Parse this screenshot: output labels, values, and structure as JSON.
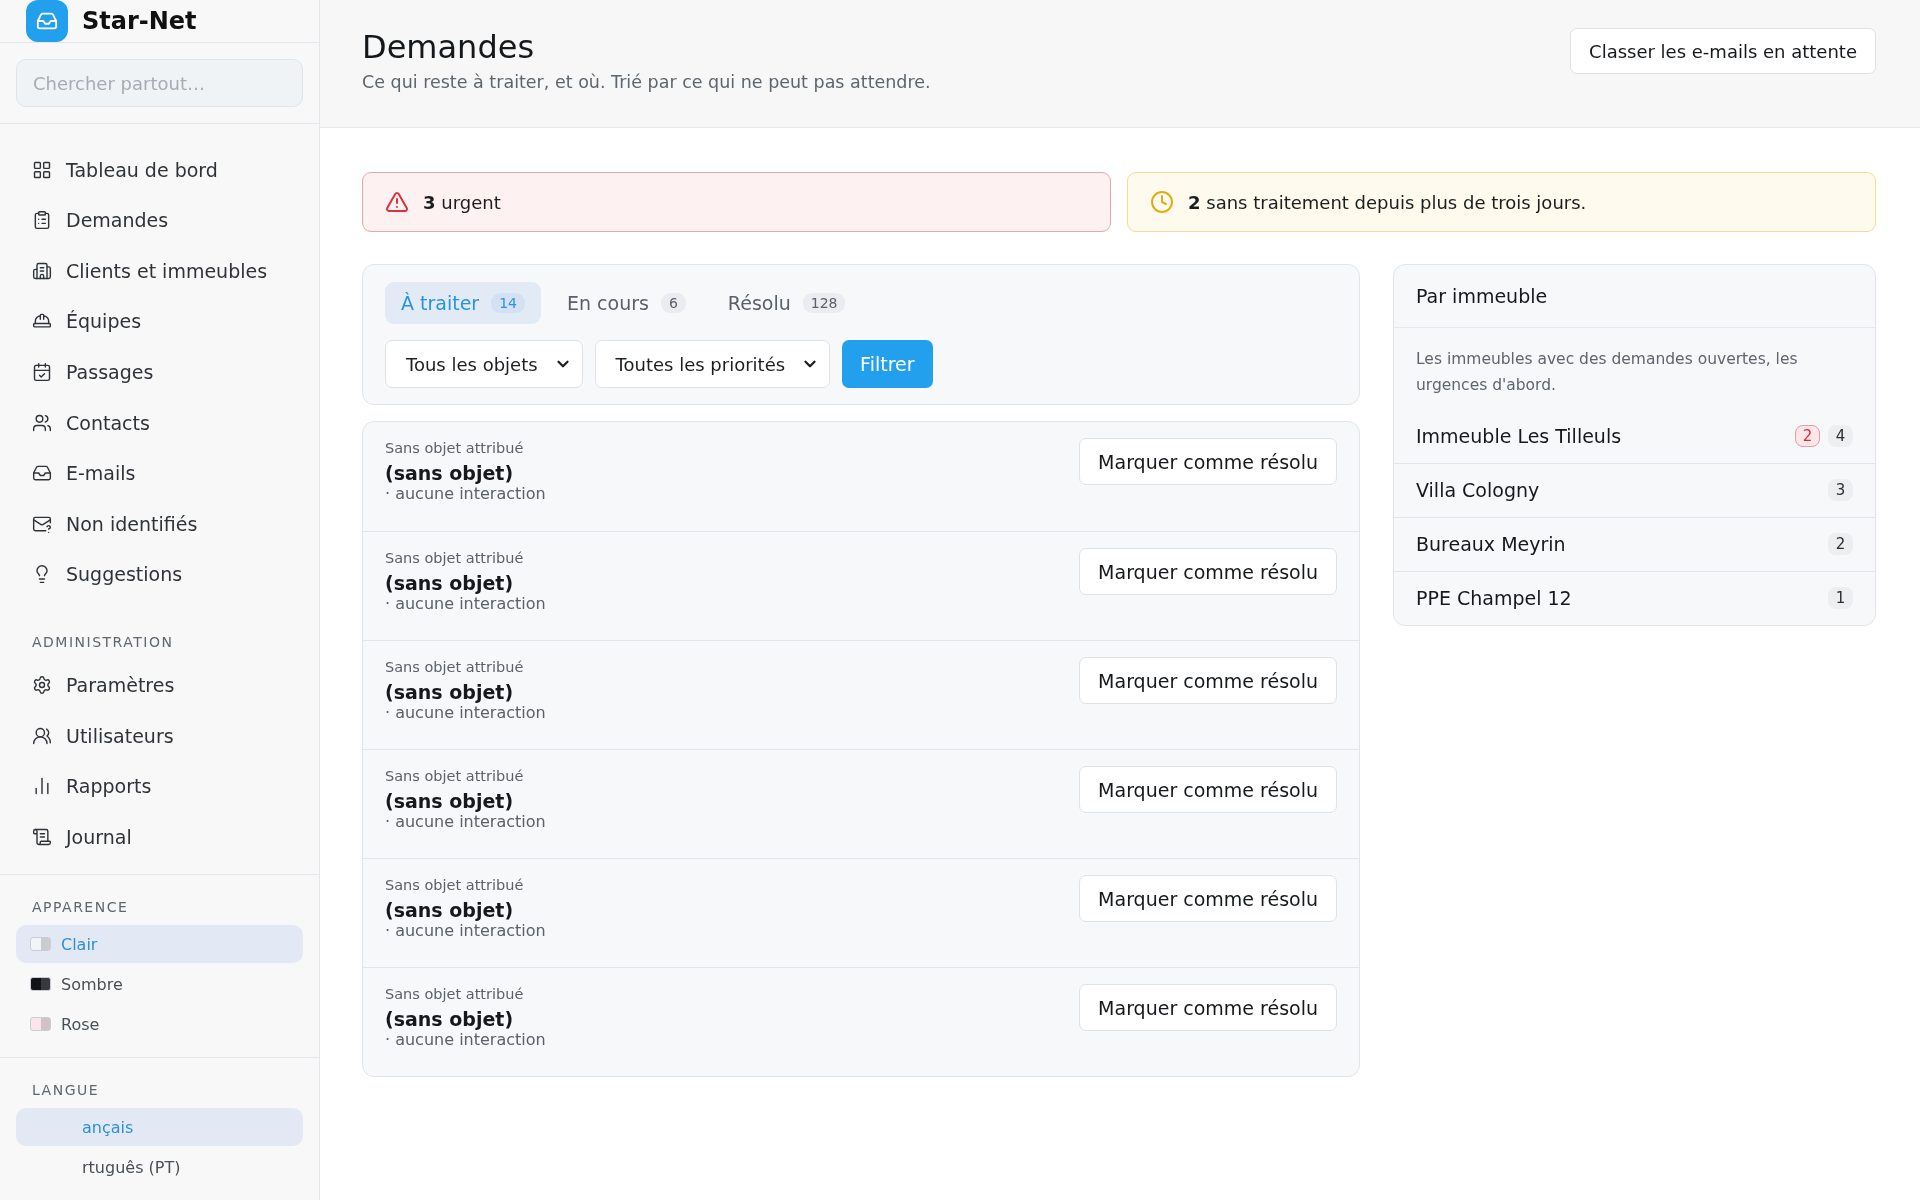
{
  "brand": {
    "name": "Star-Net"
  },
  "search": {
    "placeholder": "Chercher partout…"
  },
  "nav": [
    {
      "label": "Tableau de bord"
    },
    {
      "label": "Demandes"
    },
    {
      "label": "Clients et immeubles"
    },
    {
      "label": "Équipes"
    },
    {
      "label": "Passages"
    },
    {
      "label": "Contacts"
    },
    {
      "label": "E-mails"
    },
    {
      "label": "Non identifiés"
    },
    {
      "label": "Suggestions"
    }
  ],
  "admin": {
    "heading": "ADMINISTRATION",
    "items": [
      {
        "label": "Paramètres"
      },
      {
        "label": "Utilisateurs"
      },
      {
        "label": "Rapports"
      },
      {
        "label": "Journal"
      }
    ]
  },
  "appearance": {
    "heading": "APPARENCE",
    "items": [
      {
        "label": "Clair",
        "selected": true,
        "color": "#f3f4f6"
      },
      {
        "label": "Sombre",
        "selected": false,
        "color": "#111318"
      },
      {
        "label": "Rose",
        "selected": false,
        "color": "#fde4ea"
      }
    ]
  },
  "language": {
    "heading": "LANGUE",
    "items": [
      {
        "label": "ançais",
        "selected": true
      },
      {
        "label": "rtuguês (PT)",
        "selected": false
      }
    ]
  },
  "header": {
    "title": "Demandes",
    "subtitle": "Ce qui reste à traiter, et où. Trié par ce qui ne peut pas attendre.",
    "action": "Classer les e-mails en attente"
  },
  "alerts": [
    {
      "kind": "danger",
      "count": "3",
      "text": "urgent"
    },
    {
      "kind": "warning",
      "count": "2",
      "text": "sans traitement depuis plus de trois jours."
    }
  ],
  "tabs": [
    {
      "label": "À traiter",
      "count": "14",
      "selected": true
    },
    {
      "label": "En cours",
      "count": "6",
      "selected": false
    },
    {
      "label": "Résolu",
      "count": "128",
      "selected": false
    }
  ],
  "filters": {
    "selects": [
      "Tous les objets",
      "Toutes les priorités"
    ],
    "button": "Filtrer"
  },
  "requests": [
    {
      "category": "Sans objet attribué",
      "title": "(sans objet)",
      "meta": "· aucune interaction",
      "action": "Marquer comme résolu"
    },
    {
      "category": "Sans objet attribué",
      "title": "(sans objet)",
      "meta": "· aucune interaction",
      "action": "Marquer comme résolu"
    },
    {
      "category": "Sans objet attribué",
      "title": "(sans objet)",
      "meta": "· aucune interaction",
      "action": "Marquer comme résolu"
    },
    {
      "category": "Sans objet attribué",
      "title": "(sans objet)",
      "meta": "· aucune interaction",
      "action": "Marquer comme résolu"
    },
    {
      "category": "Sans objet attribué",
      "title": "(sans objet)",
      "meta": "· aucune interaction",
      "action": "Marquer comme résolu"
    },
    {
      "category": "Sans objet attribué",
      "title": "(sans objet)",
      "meta": "· aucune interaction",
      "action": "Marquer comme résolu"
    }
  ],
  "buildings": {
    "title": "Par immeuble",
    "description": "Les immeubles avec des demandes ouvertes, les urgences d'abord.",
    "items": [
      {
        "name": "Immeuble Les Tilleuls",
        "urgent": "2",
        "count": "4"
      },
      {
        "name": "Villa Cologny",
        "count": "3"
      },
      {
        "name": "Bureaux Meyrin",
        "count": "2"
      },
      {
        "name": "PPE Champel 12",
        "count": "1"
      }
    ]
  }
}
